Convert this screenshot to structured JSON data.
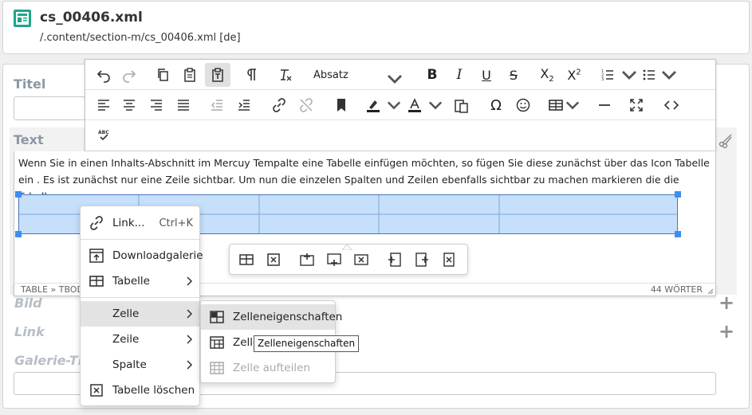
{
  "header": {
    "file_name": "cs_00406.xml",
    "file_path": "/.content/section-m/cs_00406.xml [de]"
  },
  "form": {
    "titel_label": "Titel",
    "text_label": "Text",
    "bild_label": "Bild",
    "link_label": "Link",
    "galerie_label": "Galerie-Titel"
  },
  "toolbar": {
    "paragraph_format": "Absatz"
  },
  "editor": {
    "paragraph": "Wenn Sie in einen Inhalts-Abschnitt im Mercuy Tempalte eine Tabelle einfügen möchten, so fügen Sie diese zunächst über das Icon Tabelle ein . Es ist zunächst nur eine Zeile sichtbar. Um nun die einzelen Spalten und Zeilen ebenfalls sichtbar  zu machen markieren die die Tabelle.",
    "path": "TABLE » TBODY",
    "word_count": "44 WÖRTER"
  },
  "context_menu": {
    "link_label": "Link...",
    "link_shortcut": "Ctrl+K",
    "downloadgalerie": "Downloadgalerie",
    "tabelle": "Tabelle",
    "zelle": "Zelle",
    "zeile": "Zeile",
    "spalte": "Spalte",
    "tabelle_loeschen": "Tabelle löschen"
  },
  "sub_menu": {
    "zelleneigenschaften": "Zelleneigenschaften",
    "zellen_verbinden": "Zellen verbinden",
    "zelle_aufteilen": "Zelle aufteilen"
  },
  "tooltip": "Zelleneigenschaften",
  "colors": {
    "accent": "#1fa68a",
    "selection": "#c6e0fb",
    "handle": "#3c8ef2"
  }
}
